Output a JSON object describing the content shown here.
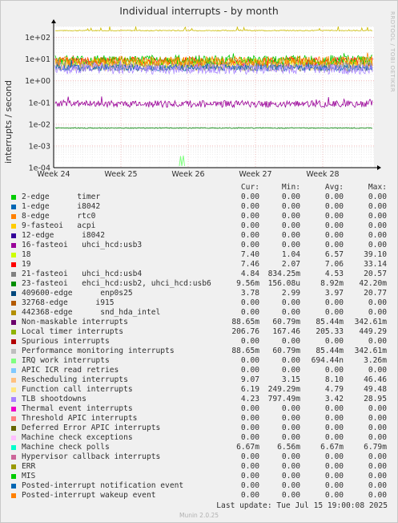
{
  "title": "Individual interrupts - by month",
  "side_tag": "RRDTOOL / TOBI OETIKER",
  "chart_data": {
    "type": "line",
    "yscale": "log",
    "ylabel": "interrupts / second",
    "ylim": [
      0.0001,
      300
    ],
    "yticks": [
      "1e+02",
      "1e+01",
      "1e+00",
      "1e-01",
      "1e-02",
      "1e-03",
      "1e-04"
    ],
    "x_ticks": [
      "Week 24",
      "Week 25",
      "Week 26",
      "Week 27",
      "Week 28"
    ],
    "series_plotted": [
      {
        "name": "Local timer interrupts",
        "color": "#CCBB00",
        "avg": 205.33,
        "min": 167.46,
        "max": 449.29
      },
      {
        "name": "19",
        "color": "#FF0000",
        "avg": 7.06,
        "min": 2.07,
        "max": 33.14
      },
      {
        "name": "18",
        "color": "#CCFF00",
        "avg": 6.57,
        "min": 1.04,
        "max": 39.1
      },
      {
        "name": "23-fasteoi ehci_hcd:usb2, uhci_hcd:usb6",
        "color": "#00CC00",
        "avg": 8.92,
        "min": 0.156,
        "max": 42.2
      },
      {
        "name": "Function call interrupts",
        "color": "#FFCC66",
        "avg": 4.79,
        "min": 0.249,
        "max": 49.48
      },
      {
        "name": "21-fasteoi uhci_hcd:usb4",
        "color": "#888888",
        "avg": 4.53,
        "min": 0.834,
        "max": 20.57
      },
      {
        "name": "409600-edge enp0s25",
        "color": "#0066B3",
        "avg": 3.97,
        "min": 2.99,
        "max": 20.77
      },
      {
        "name": "Rescheduling interrupts",
        "color": "#FF8000",
        "avg": 8.1,
        "min": 3.15,
        "max": 46.46
      },
      {
        "name": "TLB shootdowns",
        "color": "#AA88FF",
        "avg": 3.42,
        "min": 0.797,
        "max": 28.95
      },
      {
        "name": "Machine check polls",
        "color": "#008000",
        "avg": 0.00667,
        "min": 0.00656,
        "max": 0.00679
      },
      {
        "name": "Non-maskable interrupts",
        "color": "#990099",
        "avg": 0.08544,
        "min": 0.06079,
        "max": 0.34261
      },
      {
        "name": "IRQ work interrupts",
        "color": "#80FF80",
        "avg": 0.000694,
        "min": 0,
        "max": 0.00326
      }
    ]
  },
  "legend": {
    "headers": [
      "Cur:",
      "Min:",
      "Avg:",
      "Max:"
    ],
    "rows": [
      {
        "name": "2-edge      timer",
        "color": "#00CC00",
        "cur": "0.00",
        "min": "0.00",
        "avg": "0.00",
        "max": "0.00"
      },
      {
        "name": "1-edge      i8042",
        "color": "#0066B3",
        "cur": "0.00",
        "min": "0.00",
        "avg": "0.00",
        "max": "0.00"
      },
      {
        "name": "8-edge      rtc0",
        "color": "#FF8000",
        "cur": "0.00",
        "min": "0.00",
        "avg": "0.00",
        "max": "0.00"
      },
      {
        "name": "9-fasteoi   acpi",
        "color": "#FFCC00",
        "cur": "0.00",
        "min": "0.00",
        "avg": "0.00",
        "max": "0.00"
      },
      {
        "name": "12-edge      i8042",
        "color": "#330099",
        "cur": "0.00",
        "min": "0.00",
        "avg": "0.00",
        "max": "0.00"
      },
      {
        "name": "16-fasteoi   uhci_hcd:usb3",
        "color": "#990099",
        "cur": "0.00",
        "min": "0.00",
        "avg": "0.00",
        "max": "0.00"
      },
      {
        "name": "18",
        "color": "#CCFF00",
        "cur": "7.40",
        "min": "1.04",
        "avg": "6.57",
        "max": "39.10"
      },
      {
        "name": "19",
        "color": "#FF0000",
        "cur": "7.46",
        "min": "2.07",
        "avg": "7.06",
        "max": "33.14"
      },
      {
        "name": "21-fasteoi   uhci_hcd:usb4",
        "color": "#808080",
        "cur": "4.84",
        "min": "834.25m",
        "avg": "4.53",
        "max": "20.57"
      },
      {
        "name": "23-fasteoi   ehci_hcd:usb2, uhci_hcd:usb6",
        "color": "#008F00",
        "cur": "9.56m",
        "min": "156.08u",
        "avg": "8.92m",
        "max": "42.20m"
      },
      {
        "name": "409600-edge      enp0s25",
        "color": "#00487D",
        "cur": "3.78",
        "min": "2.99",
        "avg": "3.97",
        "max": "20.77"
      },
      {
        "name": "32768-edge      i915",
        "color": "#B35A00",
        "cur": "0.00",
        "min": "0.00",
        "avg": "0.00",
        "max": "0.00"
      },
      {
        "name": "442368-edge      snd_hda_intel",
        "color": "#B38F00",
        "cur": "0.00",
        "min": "0.00",
        "avg": "0.00",
        "max": "0.00"
      },
      {
        "name": "Non-maskable interrupts",
        "color": "#6B006B",
        "cur": "88.65m",
        "min": "60.79m",
        "avg": "85.44m",
        "max": "342.61m"
      },
      {
        "name": "Local timer interrupts",
        "color": "#8FB300",
        "cur": "206.76",
        "min": "167.46",
        "avg": "205.33",
        "max": "449.29"
      },
      {
        "name": "Spurious interrupts",
        "color": "#B30000",
        "cur": "0.00",
        "min": "0.00",
        "avg": "0.00",
        "max": "0.00"
      },
      {
        "name": "Performance monitoring interrupts",
        "color": "#BEBEBE",
        "cur": "88.65m",
        "min": "60.79m",
        "avg": "85.44m",
        "max": "342.61m"
      },
      {
        "name": "IRQ work interrupts",
        "color": "#80FF80",
        "cur": "0.00",
        "min": "0.00",
        "avg": "694.44n",
        "max": "3.26m"
      },
      {
        "name": "APIC ICR read retries",
        "color": "#80C9FF",
        "cur": "0.00",
        "min": "0.00",
        "avg": "0.00",
        "max": "0.00"
      },
      {
        "name": "Rescheduling interrupts",
        "color": "#FFC080",
        "cur": "9.07",
        "min": "3.15",
        "avg": "8.10",
        "max": "46.46"
      },
      {
        "name": "Function call interrupts",
        "color": "#FFE680",
        "cur": "6.19",
        "min": "249.29m",
        "avg": "4.79",
        "max": "49.48"
      },
      {
        "name": "TLB shootdowns",
        "color": "#AA80FF",
        "cur": "4.23",
        "min": "797.49m",
        "avg": "3.42",
        "max": "28.95"
      },
      {
        "name": "Thermal event interrupts",
        "color": "#EE00CC",
        "cur": "0.00",
        "min": "0.00",
        "avg": "0.00",
        "max": "0.00"
      },
      {
        "name": "Threshold APIC interrupts",
        "color": "#FF8080",
        "cur": "0.00",
        "min": "0.00",
        "avg": "0.00",
        "max": "0.00"
      },
      {
        "name": "Deferred Error APIC interrupts",
        "color": "#666600",
        "cur": "0.00",
        "min": "0.00",
        "avg": "0.00",
        "max": "0.00"
      },
      {
        "name": "Machine check exceptions",
        "color": "#FFBFFF",
        "cur": "0.00",
        "min": "0.00",
        "avg": "0.00",
        "max": "0.00"
      },
      {
        "name": "Machine check polls",
        "color": "#00FFCC",
        "cur": "6.67m",
        "min": "6.56m",
        "avg": "6.67m",
        "max": "6.79m"
      },
      {
        "name": "Hypervisor callback interrupts",
        "color": "#CC6699",
        "cur": "0.00",
        "min": "0.00",
        "avg": "0.00",
        "max": "0.00"
      },
      {
        "name": "ERR",
        "color": "#999900",
        "cur": "0.00",
        "min": "0.00",
        "avg": "0.00",
        "max": "0.00"
      },
      {
        "name": "MIS",
        "color": "#00CC00",
        "cur": "0.00",
        "min": "0.00",
        "avg": "0.00",
        "max": "0.00"
      },
      {
        "name": "Posted-interrupt notification event",
        "color": "#0066B3",
        "cur": "0.00",
        "min": "0.00",
        "avg": "0.00",
        "max": "0.00"
      },
      {
        "name": "Posted-interrupt wakeup event",
        "color": "#FF8000",
        "cur": "0.00",
        "min": "0.00",
        "avg": "0.00",
        "max": "0.00"
      }
    ]
  },
  "last_update": "Last update:  Tue Jul 15 19:00:08 2025",
  "footer": "Munin 2.0.25"
}
